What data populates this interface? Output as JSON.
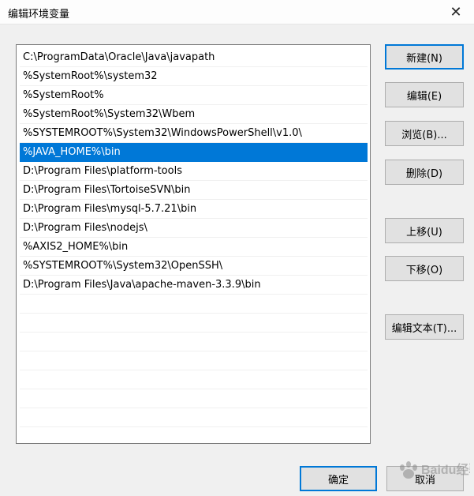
{
  "window": {
    "title": "编辑环境变量",
    "close_glyph": "✕"
  },
  "path_list": {
    "items": [
      "C:\\ProgramData\\Oracle\\Java\\javapath",
      "%SystemRoot%\\system32",
      "%SystemRoot%",
      "%SystemRoot%\\System32\\Wbem",
      "%SYSTEMROOT%\\System32\\WindowsPowerShell\\v1.0\\",
      "%JAVA_HOME%\\bin",
      "D:\\Program Files\\platform-tools",
      "D:\\Program Files\\TortoiseSVN\\bin",
      "D:\\Program Files\\mysql-5.7.21\\bin",
      "D:\\Program Files\\nodejs\\",
      "%AXIS2_HOME%\\bin",
      "%SYSTEMROOT%\\System32\\OpenSSH\\",
      "D:\\Program Files\\Java\\apache-maven-3.3.9\\bin"
    ],
    "selected_index": 5,
    "colors": {
      "selection": "#0078d7"
    }
  },
  "buttons": {
    "new": "新建(N)",
    "edit": "编辑(E)",
    "browse": "浏览(B)...",
    "delete": "删除(D)",
    "move_up": "上移(U)",
    "move_down": "下移(O)",
    "edit_text": "编辑文本(T)...",
    "ok": "确定",
    "cancel": "取消"
  },
  "watermark": {
    "text": "Baidu经验",
    "icon": "baidu-paw-icon"
  }
}
